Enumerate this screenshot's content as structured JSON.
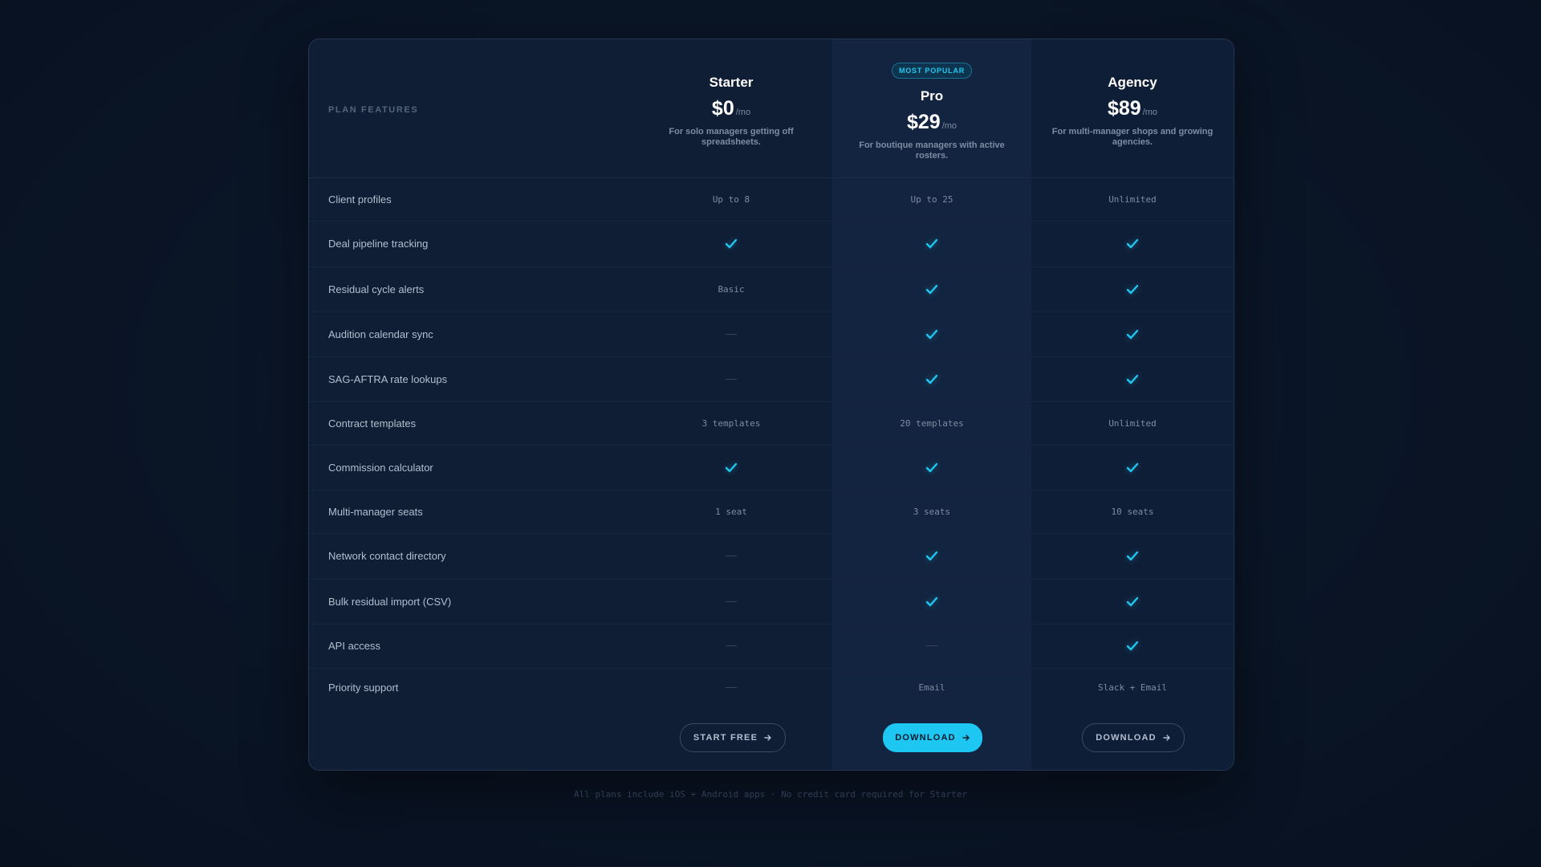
{
  "header": {
    "features_label": "PLAN FEATURES",
    "badge": "MOST POPULAR"
  },
  "plans": [
    {
      "name": "Starter",
      "price": "$0",
      "period": "/mo",
      "desc": "For solo managers getting off spreadsheets.",
      "cta": "START FREE"
    },
    {
      "name": "Pro",
      "price": "$29",
      "period": "/mo",
      "desc": "For boutique managers with active rosters.",
      "cta": "DOWNLOAD"
    },
    {
      "name": "Agency",
      "price": "$89",
      "period": "/mo",
      "desc": "For multi-manager shops and growing agencies.",
      "cta": "DOWNLOAD"
    }
  ],
  "rows": [
    {
      "label": "Client profiles",
      "values": [
        "Up to 8",
        "Up to 25",
        "Unlimited"
      ]
    },
    {
      "label": "Deal pipeline tracking",
      "values": [
        "check",
        "check",
        "check"
      ]
    },
    {
      "label": "Residual cycle alerts",
      "values": [
        "Basic",
        "check",
        "check"
      ]
    },
    {
      "label": "Audition calendar sync",
      "values": [
        "dash",
        "check",
        "check"
      ]
    },
    {
      "label": "SAG-AFTRA rate lookups",
      "values": [
        "dash",
        "check",
        "check"
      ]
    },
    {
      "label": "Contract templates",
      "values": [
        "3 templates",
        "20 templates",
        "Unlimited"
      ]
    },
    {
      "label": "Commission calculator",
      "values": [
        "check",
        "check",
        "check"
      ]
    },
    {
      "label": "Multi-manager seats",
      "values": [
        "1 seat",
        "3 seats",
        "10 seats"
      ]
    },
    {
      "label": "Network contact directory",
      "values": [
        "dash",
        "check",
        "check"
      ]
    },
    {
      "label": "Bulk residual import (CSV)",
      "values": [
        "dash",
        "check",
        "check"
      ]
    },
    {
      "label": "API access",
      "values": [
        "dash",
        "dash",
        "check"
      ]
    },
    {
      "label": "Priority support",
      "values": [
        "dash",
        "Email",
        "Slack + Email"
      ]
    }
  ],
  "footnote": "All plans include iOS + Android apps · No credit card required for Starter",
  "colors": {
    "accent": "#1ec6f2",
    "background": "#0a1526",
    "card": "#0f1d35"
  }
}
